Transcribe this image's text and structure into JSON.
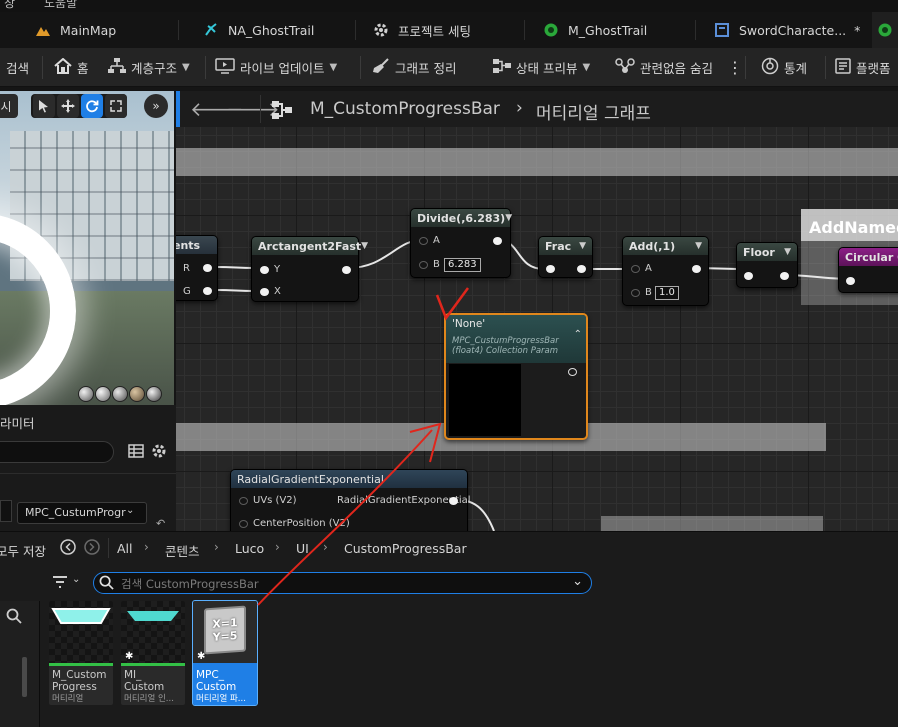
{
  "menu": {
    "items": [
      "창",
      "도움말"
    ]
  },
  "tabs": [
    {
      "label": "MainMap",
      "icon": "level-icon"
    },
    {
      "label": "NA_GhostTrail",
      "icon": "niagara-icon"
    },
    {
      "label": "프로젝트 세팅",
      "icon": "settings-icon"
    },
    {
      "label": "M_GhostTrail",
      "icon": "material-icon"
    },
    {
      "label": "SwordCharacte...",
      "icon": "blueprint-icon",
      "modified_mark": "*"
    }
  ],
  "toolbar": {
    "search": "검색",
    "home": "홈",
    "hierarchy": "계층구조",
    "live_update": "라이브 업데이트",
    "clean_graph": "그래프 정리",
    "state_preview": "상태 프리뷰",
    "hide_unrelated": "관련없음 숨김",
    "stats": "통계",
    "platform": "플랫폼"
  },
  "viewport": {
    "partial_label": "시",
    "buttons": [
      "select-icon",
      "move-icon",
      "realtime-icon",
      "maximize-icon"
    ],
    "more": "»"
  },
  "details": {
    "title": "라미터",
    "collection_value": "MPC_CustumProgr",
    "save_all_partial": "모두 저장"
  },
  "graph": {
    "title": "M_CustomProgressBar",
    "separator": "›",
    "subtitle": "머티리얼 그래프",
    "comment_label_1": "AddNamed",
    "nodes": {
      "partial": {
        "title": "ents",
        "outputs": [
          "R",
          "G"
        ]
      },
      "arctan": {
        "title": "Arctangent2Fast",
        "inputs": [
          "Y",
          "X"
        ]
      },
      "divide": {
        "title": "Divide(,6.283)",
        "inputs": [
          "A",
          "B"
        ],
        "b_value": "6.283"
      },
      "frac": {
        "title": "Frac"
      },
      "add": {
        "title": "Add(,1)",
        "inputs": [
          "A",
          "B"
        ],
        "b_value": "1.0"
      },
      "floor": {
        "title": "Floor"
      },
      "circular": {
        "title": "Circular Gr"
      },
      "collection": {
        "title": "'None'",
        "subtitle_1": "MPC_CustumProgressBar",
        "subtitle_2": "(float4) Collection Param"
      },
      "radial": {
        "title": "RadialGradientExponential",
        "inputs": [
          "UVs (V2)",
          "CenterPosition (V2)"
        ],
        "output": "RadialGradientExponential"
      }
    }
  },
  "content_browser": {
    "breadcrumbs": [
      "All",
      "콘텐츠",
      "Luco",
      "UI",
      "CustomProgressBar"
    ],
    "search_placeholder": "검색 CustomProgressBar",
    "assets": [
      {
        "name": "M_Custom Progress",
        "type": "머티리얼"
      },
      {
        "name": "MI_ Custom",
        "type": "머티리얼 인..."
      },
      {
        "name": "MPC_ Custom",
        "type": "머티리얼 파...",
        "icon_text_1": "X=1",
        "icon_text_2": "Y=5"
      }
    ]
  },
  "colors": {
    "accent_blue": "#1f7fe6",
    "node_select_orange": "#e0871c",
    "annotation_red": "#e0261c",
    "material_green": "#33c046"
  }
}
